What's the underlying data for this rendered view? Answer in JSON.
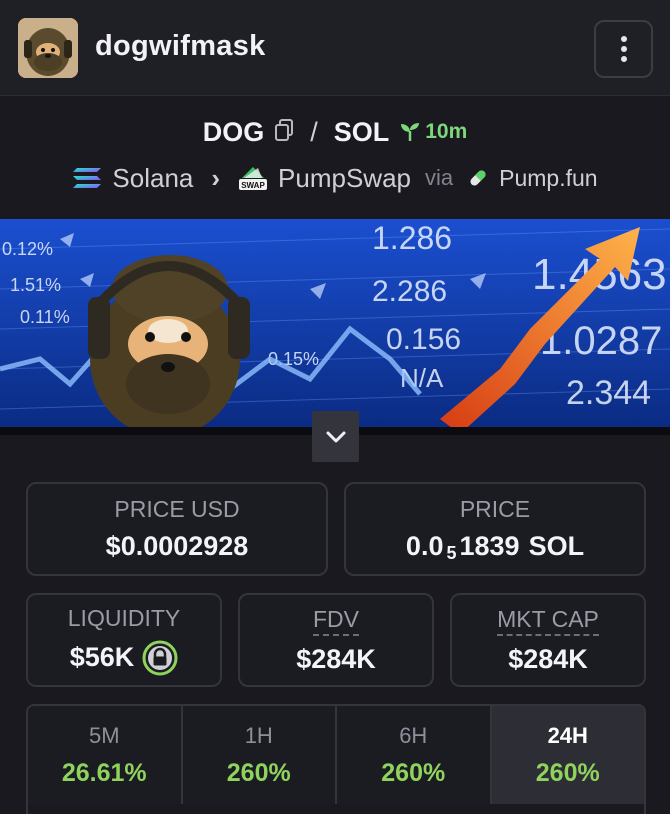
{
  "header": {
    "token_name": "dogwifmask",
    "avatar_icon": "dog-mask-avatar",
    "menu_icon": "vertical-dots-icon"
  },
  "pair": {
    "base": "DOG",
    "quote": "SOL",
    "age": "10m",
    "copy_icon": "copy-icon",
    "age_icon": "sprout-icon"
  },
  "route": {
    "chain": "Solana",
    "dex": "PumpSwap",
    "via": "via",
    "launchpad": "Pump.fun"
  },
  "banner": {
    "ticker_numbers": [
      "1.286",
      "2.286",
      "0.156",
      "N/A",
      "1.4563",
      "1.0287",
      "2.344",
      "0.12%",
      "1.51%",
      "0.11%",
      "0.15%"
    ]
  },
  "stats": {
    "price_usd": {
      "label": "PRICE USD",
      "value": "$0.0002928"
    },
    "price_native": {
      "label": "PRICE",
      "prefix": "0.0",
      "zeros": "5",
      "digits": "1839",
      "unit": "SOL"
    },
    "liquidity": {
      "label": "LIQUIDITY",
      "value": "$56K"
    },
    "fdv": {
      "label": "FDV",
      "value": "$284K"
    },
    "mkt_cap": {
      "label": "MKT CAP",
      "value": "$284K"
    }
  },
  "timeframes": [
    {
      "label": "5M",
      "value": "26.61%",
      "active": false
    },
    {
      "label": "1H",
      "value": "260%",
      "active": false
    },
    {
      "label": "6H",
      "value": "260%",
      "active": false
    },
    {
      "label": "24H",
      "value": "260%",
      "active": true
    }
  ],
  "colors": {
    "positive": "#8fd35c",
    "age_green": "#7ed77b",
    "background": "#19191f"
  }
}
